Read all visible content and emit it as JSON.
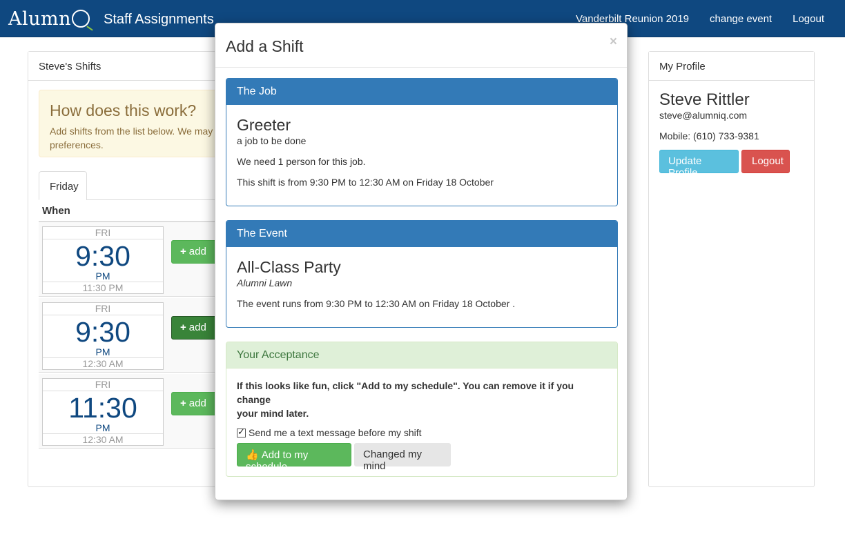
{
  "nav": {
    "brand_text": "Alumn",
    "title": "Staff Assignments",
    "event_name": "Vanderbilt Reunion 2019",
    "change_event": "change event",
    "logout": "Logout"
  },
  "shifts": {
    "header": "Steve's Shifts",
    "alert_title": "How does this work?",
    "alert_line1": "Add shifts from the list below. We may",
    "alert_line2": "preferences.",
    "tab": "Friday",
    "when_header": "When",
    "add_label": "add",
    "rows": [
      {
        "day": "FRI",
        "time": "9:30",
        "ampm": "PM",
        "end": "11:30 PM"
      },
      {
        "day": "FRI",
        "time": "9:30",
        "ampm": "PM",
        "end": "12:30 AM"
      },
      {
        "day": "FRI",
        "time": "11:30",
        "ampm": "PM",
        "end": "12:30 AM"
      }
    ]
  },
  "profile": {
    "header": "My Profile",
    "name": "Steve Rittler",
    "email": "steve@alumniq.com",
    "mobile": "Mobile: (610) 733-9381",
    "update_button": "Update Profile",
    "logout_button": "Logout"
  },
  "modal": {
    "title": "Add a Shift",
    "close": "×",
    "job": {
      "header": "The Job",
      "name": "Greeter",
      "description": "a job to be done",
      "need": "We need 1 person for this job.",
      "time": "This shift is from 9:30 PM to 12:30 AM on Friday 18 October"
    },
    "event": {
      "header": "The Event",
      "name": "All-Class Party",
      "location": "Alumni Lawn",
      "time": "The event runs from 9:30 PM to 12:30 AM on Friday 18 October ."
    },
    "acceptance": {
      "header": "Your Acceptance",
      "line1": "If this looks like fun, click \"Add to my schedule\". You can remove it if you change",
      "line2": "your mind later.",
      "checkbox_label": "Send me a text message before my shift",
      "checkbox_checked": true,
      "add_button": "Add to my schedule",
      "cancel_button": "Changed my mind"
    }
  },
  "icons": {
    "plus": "plus-icon",
    "thumbs_up": "thumbs-up-icon",
    "close": "close-icon"
  },
  "colors": {
    "navbar": "#0f4880",
    "primary": "#337ab7",
    "success": "#5cb85c",
    "info": "#5bc0de",
    "danger": "#d9534f"
  }
}
